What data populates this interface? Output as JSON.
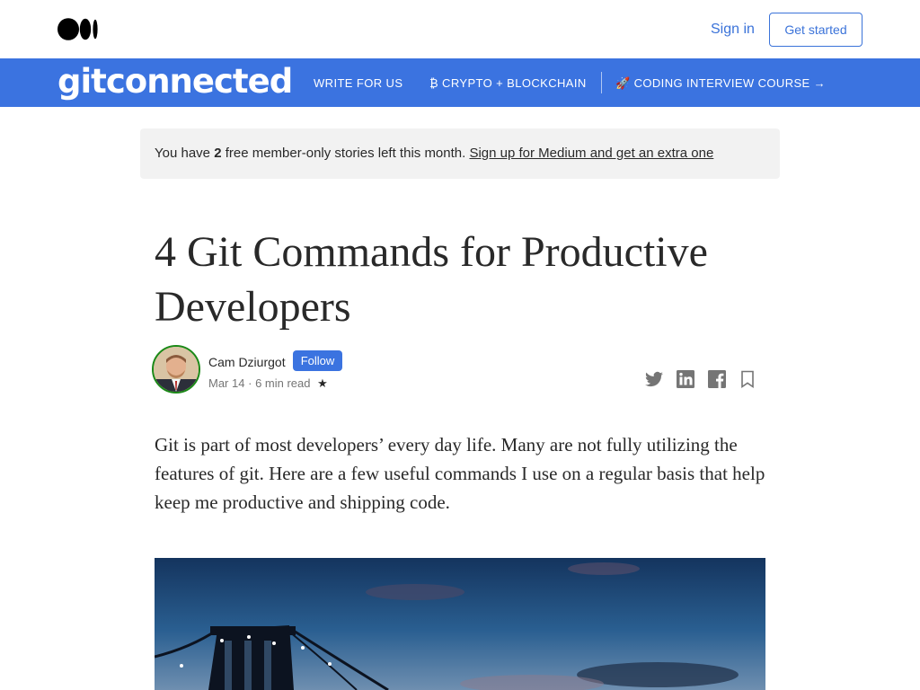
{
  "topbar": {
    "sign_in": "Sign in",
    "get_started": "Get started"
  },
  "publication": {
    "name": "gitconnected",
    "nav": [
      {
        "label": "WRITE FOR US"
      },
      {
        "label": "₿ CRYPTO + BLOCKCHAIN"
      },
      {
        "label": "🚀 CODING INTERVIEW COURSE →"
      }
    ]
  },
  "banner": {
    "prefix": "You have ",
    "count": "2",
    "middle": " free member-only stories left this month. ",
    "link": "Sign up for Medium and get an extra one"
  },
  "article": {
    "title": "4 Git Commands for Productive Developers",
    "author": "Cam Dziurgot",
    "follow": "Follow",
    "date": "Mar 14",
    "separator": "·",
    "read_time": "6 min read",
    "star": "★",
    "body": "Git is part of most developers’ every day life. Many are not fully utilizing the features of git. Here are a few useful commands I use on a regular basis that help keep me productive and shipping code."
  },
  "colors": {
    "accent": "#3b73e0",
    "member_ring": "#1a8917",
    "text": "#292929",
    "muted": "#757575",
    "banner_bg": "#f2f2f2"
  },
  "icons": [
    "medium-logo-icon",
    "twitter-icon",
    "linkedin-icon",
    "facebook-icon",
    "bookmark-icon"
  ]
}
